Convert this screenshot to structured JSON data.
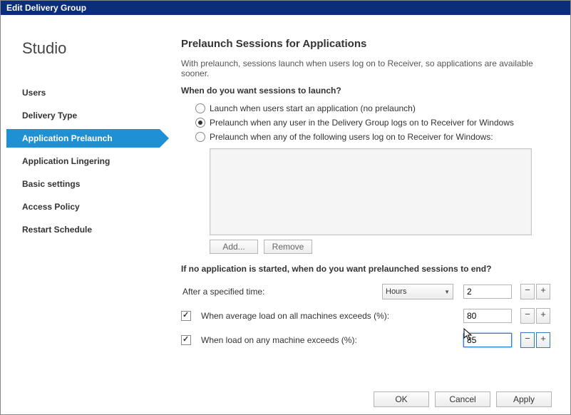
{
  "titlebar": "Edit Delivery Group",
  "sidebar": {
    "title": "Studio",
    "items": [
      {
        "label": "Users"
      },
      {
        "label": "Delivery Type"
      },
      {
        "label": "Application Prelaunch",
        "selected": true
      },
      {
        "label": "Application Lingering"
      },
      {
        "label": "Basic settings"
      },
      {
        "label": "Access Policy"
      },
      {
        "label": "Restart Schedule"
      }
    ]
  },
  "main": {
    "title": "Prelaunch Sessions for Applications",
    "intro": "With prelaunch, sessions launch when users log on to Receiver, so applications are available sooner.",
    "question": "When do you want sessions to launch?",
    "radios": [
      {
        "label": "Launch when users start an application (no prelaunch)",
        "checked": false
      },
      {
        "label": "Prelaunch when any user in the Delivery Group logs on to Receiver for Windows",
        "checked": true
      },
      {
        "label": "Prelaunch when any of the following users log on to Receiver for Windows:",
        "checked": false
      }
    ],
    "add_btn": "Add...",
    "remove_btn": "Remove",
    "end_question": "If no application is started, when do you want prelaunched sessions to end?",
    "time_label": "After a specified time:",
    "time_unit": "Hours",
    "time_value": "2",
    "avg_label": "When average load on all machines exceeds (%):",
    "avg_checked": true,
    "avg_value": "80",
    "any_label": "When load on any machine exceeds (%):",
    "any_checked": true,
    "any_value": "85"
  },
  "footer": {
    "ok": "OK",
    "cancel": "Cancel",
    "apply": "Apply"
  }
}
